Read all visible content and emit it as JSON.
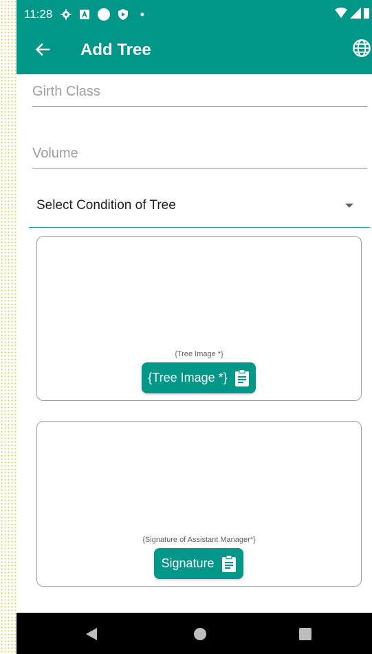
{
  "status_bar": {
    "time": "11:28",
    "icons": [
      "gear-icon",
      "a-icon",
      "circle-icon",
      "shield-icon",
      "dot-icon"
    ],
    "right_icons": [
      "wifi-icon",
      "signal-icon",
      "battery-icon"
    ]
  },
  "app_bar": {
    "title": "Add Tree",
    "back_icon": "arrow-left-icon",
    "action_icon": "globe-icon"
  },
  "form": {
    "girth_placeholder": "Girth Class",
    "volume_placeholder": "Volume",
    "condition_dropdown": "Select Condition of Tree"
  },
  "tree_image_card": {
    "caption": "{Tree Image *}",
    "button_label": "{Tree Image *}"
  },
  "signature_card": {
    "caption": "{Signature of Assistant Manager*}",
    "button_label": "Signature"
  },
  "colors": {
    "primary": "#009688",
    "nav": "#000000"
  }
}
